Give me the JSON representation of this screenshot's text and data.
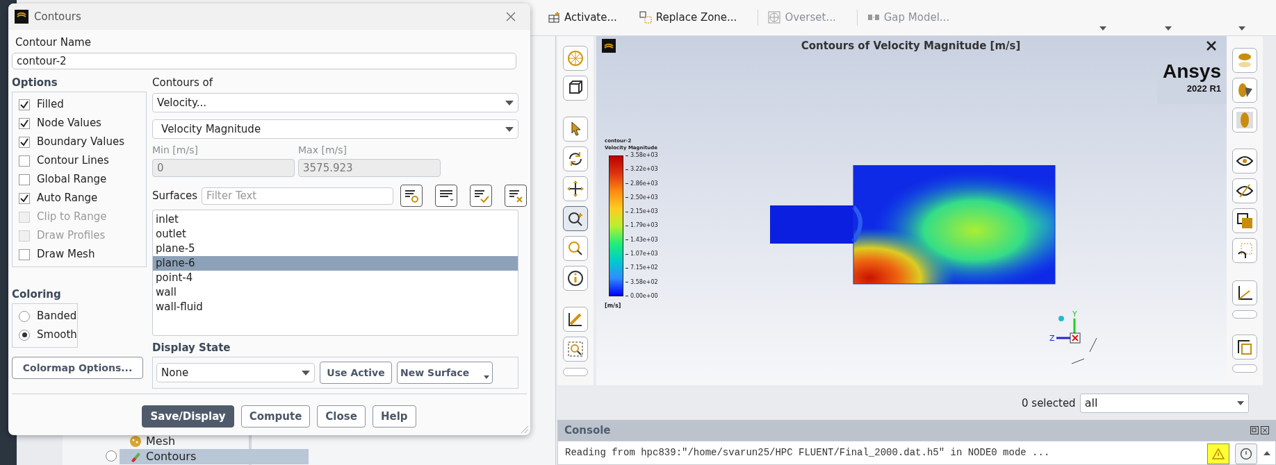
{
  "ribbon": {
    "items": [
      {
        "label": "Activate...",
        "disabled": false
      },
      {
        "label": "Replace Zone...",
        "disabled": false
      },
      {
        "label": "Overset...",
        "disabled": true
      },
      {
        "label": "Gap Model...",
        "disabled": true
      }
    ]
  },
  "tree": {
    "items": [
      {
        "label": "Mesh",
        "selected": false
      },
      {
        "label": "Contours",
        "selected": true
      }
    ]
  },
  "graphics": {
    "title": "Contours of Velocity Magnitude [m/s]",
    "brand": "Ansys",
    "version": "2022 R1",
    "legend": {
      "title": "contour-2",
      "subtitle": "Velocity Magnitude",
      "unit": "[m/s]",
      "labels": [
        "3.58e+03",
        "3.22e+03",
        "2.86e+03",
        "2.50e+03",
        "2.15e+03",
        "1.79e+03",
        "1.43e+03",
        "1.07e+03",
        "7.15e+02",
        "3.58e+02",
        "0.00e+00"
      ]
    },
    "triad": {
      "y": "Y",
      "z": "Z"
    }
  },
  "selection": {
    "count": "0 selected",
    "filter": "all"
  },
  "console": {
    "title": "Console",
    "lines": [
      "Reading from hpc839:\"/home/svarun25/HPC FLUENT/Final_2000.dat.h5\" in NODE0 mode ..."
    ]
  },
  "dialog": {
    "title": "Contours",
    "name_label": "Contour Name",
    "name_value": "contour-2",
    "options_title": "Options",
    "options": [
      {
        "label": "Filled",
        "checked": true,
        "disabled": false
      },
      {
        "label": "Node Values",
        "checked": true,
        "disabled": false
      },
      {
        "label": "Boundary Values",
        "checked": true,
        "disabled": false
      },
      {
        "label": "Contour Lines",
        "checked": false,
        "disabled": false
      },
      {
        "label": "Global Range",
        "checked": false,
        "disabled": false
      },
      {
        "label": "Auto Range",
        "checked": true,
        "disabled": false
      },
      {
        "label": "Clip to Range",
        "checked": false,
        "disabled": true
      },
      {
        "label": "Draw Profiles",
        "checked": false,
        "disabled": true
      },
      {
        "label": "Draw Mesh",
        "checked": false,
        "disabled": false
      }
    ],
    "coloring_title": "Coloring",
    "coloring": [
      {
        "label": "Banded",
        "selected": false
      },
      {
        "label": "Smooth",
        "selected": true
      }
    ],
    "colormap_button": "Colormap Options...",
    "contours_of_label": "Contours of",
    "field": "Velocity...",
    "component": "Velocity Magnitude",
    "min_label": "Min [m/s]",
    "min_value": "0",
    "max_label": "Max [m/s]",
    "max_value": "3575.923",
    "surfaces_label": "Surfaces",
    "filter_placeholder": "Filter Text",
    "surfaces": [
      {
        "label": "inlet",
        "selected": false
      },
      {
        "label": "outlet",
        "selected": false
      },
      {
        "label": "plane-5",
        "selected": false
      },
      {
        "label": "plane-6",
        "selected": true
      },
      {
        "label": "point-4",
        "selected": false
      },
      {
        "label": "wall",
        "selected": false
      },
      {
        "label": "wall-fluid",
        "selected": false
      }
    ],
    "display_state_label": "Display State",
    "display_state": "None",
    "state_buttons": [
      "Use Active",
      "New Surface"
    ],
    "buttons": [
      {
        "label": "Save/Display",
        "kind": "primary"
      },
      {
        "label": "Compute",
        "kind": "normal"
      },
      {
        "label": "Close",
        "kind": "normal"
      },
      {
        "label": "Help",
        "kind": "normal"
      }
    ]
  }
}
